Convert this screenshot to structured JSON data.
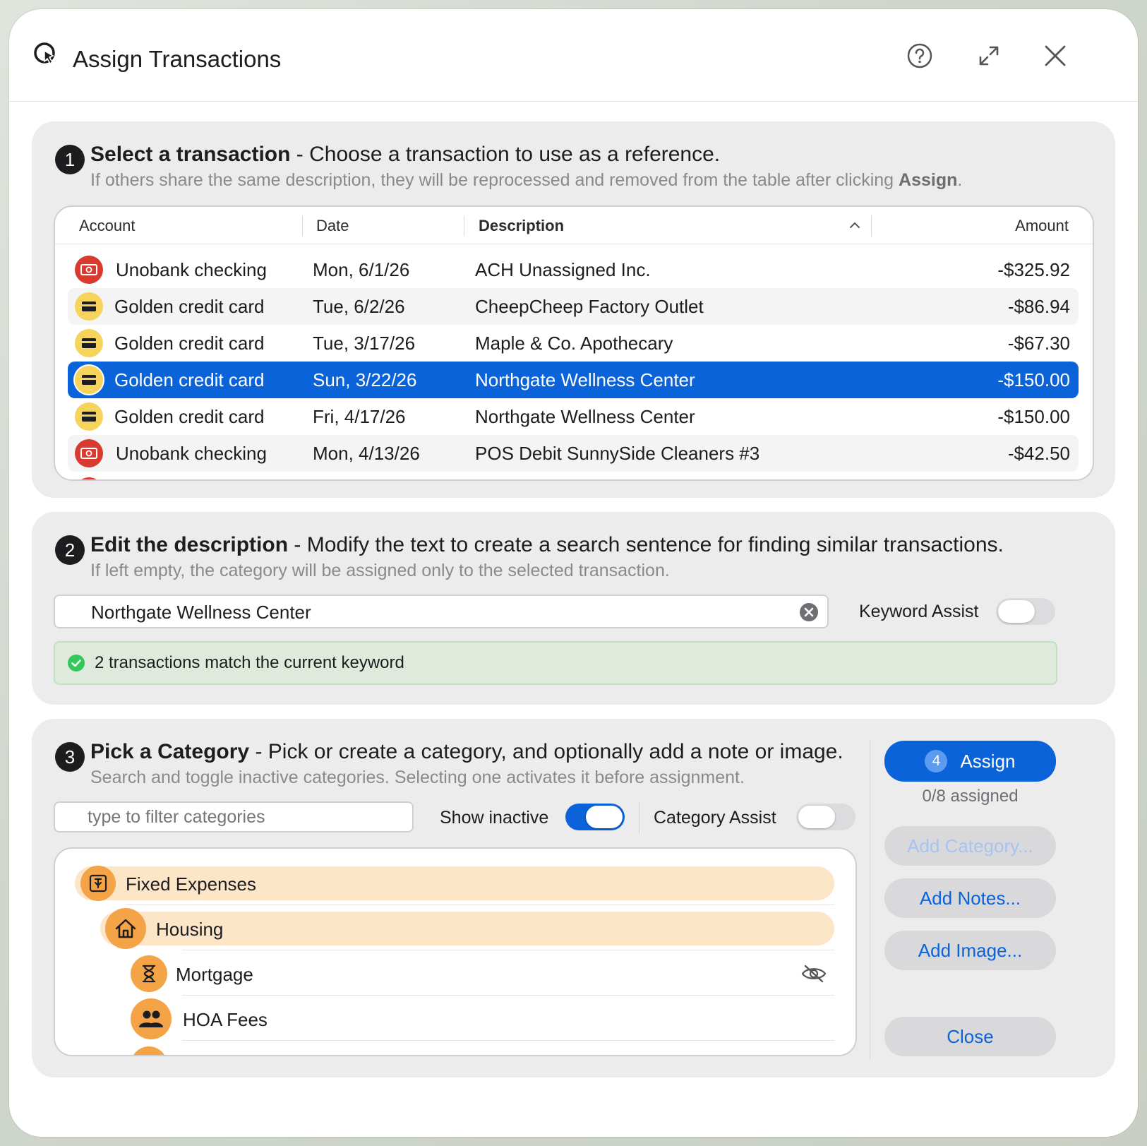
{
  "window": {
    "title": "Assign Transactions",
    "title_icon": "search-pointer-icon",
    "help_icon": "question-circle-icon",
    "expand_icon": "expand-arrows-icon",
    "close_icon": "close-x-icon"
  },
  "step1": {
    "number": "1",
    "title": "Select a transaction",
    "dash": " - ",
    "subtitle": "Choose a transaction to use as a reference.",
    "hint_prefix": "If others share the same description, they will be reprocessed and removed from the table after clicking ",
    "hint_bold": "Assign",
    "hint_suffix": ".",
    "columns": {
      "account": "Account",
      "date": "Date",
      "description": "Description",
      "amount": "Amount"
    },
    "sort_icon": "chevron-up-icon",
    "rows": [
      {
        "account": "Unobank checking",
        "icon": "bank-icon",
        "date": "Mon, 6/1/26",
        "description": "ACH Unassigned Inc.",
        "amount": "-$325.92"
      },
      {
        "account": "Golden credit card",
        "icon": "credit-card-icon",
        "date": "Tue, 6/2/26",
        "description": "CheepCheep Factory Outlet",
        "amount": "-$86.94"
      },
      {
        "account": "Golden credit card",
        "icon": "credit-card-icon",
        "date": "Tue, 3/17/26",
        "description": "Maple & Co. Apothecary",
        "amount": "-$67.30"
      },
      {
        "account": "Golden credit card",
        "icon": "credit-card-icon",
        "date": "Sun, 3/22/26",
        "description": "Northgate Wellness Center",
        "amount": "-$150.00",
        "selected": true
      },
      {
        "account": "Golden credit card",
        "icon": "credit-card-icon",
        "date": "Fri, 4/17/26",
        "description": "Northgate Wellness Center",
        "amount": "-$150.00"
      },
      {
        "account": "Unobank checking",
        "icon": "bank-icon",
        "date": "Mon, 4/13/26",
        "description": "POS Debit SunnySide Cleaners #3",
        "amount": "-$42.50"
      }
    ]
  },
  "step2": {
    "number": "2",
    "title": "Edit the description",
    "dash": " - ",
    "subtitle": "Modify the text to create a search sentence for finding similar transactions.",
    "hint": "If left empty, the category will be assigned only to the selected transaction.",
    "input_value": "Northgate Wellness Center",
    "keyword_assist_label": "Keyword Assist",
    "keyword_assist_on": false,
    "match_text": "2 transactions match the current keyword"
  },
  "step3": {
    "number": "3",
    "title": "Pick a Category",
    "dash": " - ",
    "subtitle": "Pick or create a category, and optionally add a note or image.",
    "hint": "Search and toggle inactive categories. Selecting one activates it before assignment.",
    "filter_placeholder": "type to filter categories",
    "show_inactive_label": "Show inactive",
    "show_inactive_on": true,
    "category_assist_label": "Category Assist",
    "category_assist_on": false,
    "categories": [
      {
        "label": "Fixed Expenses",
        "icon": "pin-icon",
        "level": 0,
        "highlighted": true
      },
      {
        "label": "Housing",
        "icon": "house-icon",
        "level": 1,
        "highlighted": true
      },
      {
        "label": "Mortgage",
        "icon": "hourglass-icon",
        "level": 2,
        "inactive_icon": "eye-slash-icon"
      },
      {
        "label": "HOA Fees",
        "icon": "people-icon",
        "level": 2
      }
    ]
  },
  "sidebar": {
    "assign_badge": "4",
    "assign_label": "Assign",
    "assigned_count": "0/8 assigned",
    "add_category": "Add Category...",
    "add_notes": "Add Notes...",
    "add_image": "Add Image...",
    "close": "Close"
  },
  "colors": {
    "accent": "#0a63d8",
    "bank_red": "#d83a2f",
    "card_yellow": "#f6d35a",
    "category_orange": "#f5a347",
    "highlight_peach": "#fde5c8",
    "success_green": "#34c759"
  }
}
